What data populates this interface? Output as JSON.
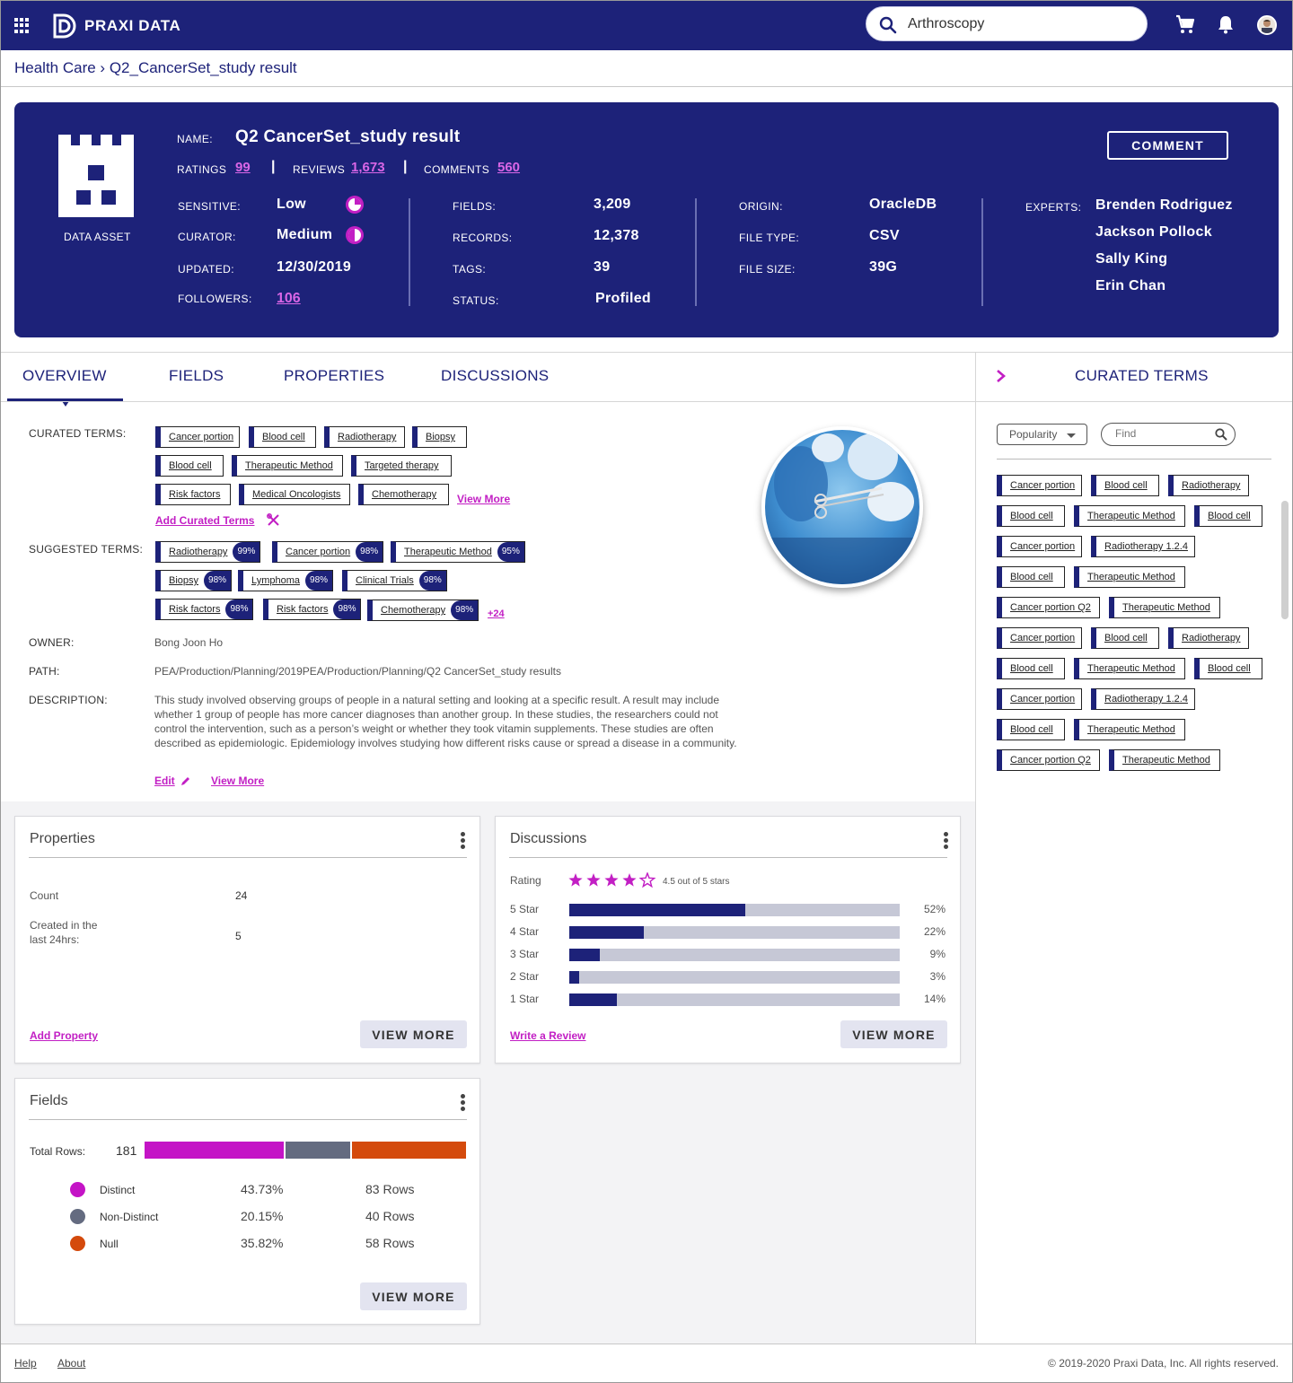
{
  "app": {
    "title": "PRAXI DATA",
    "search_value": "Arthroscopy",
    "icons": [
      "apps-grid-icon",
      "search-icon",
      "cart-icon",
      "bell-icon",
      "avatar"
    ]
  },
  "breadcrumb": "Health Care › Q2_CancerSet_study result",
  "asset": {
    "type_label": "DATA ASSET",
    "name_label": "NAME:",
    "name": "Q2 CancerSet_study result",
    "ratings_label": "RATINGS",
    "ratings": "99",
    "reviews_label": "REVIEWS",
    "reviews": "1,673",
    "comments_label": "COMMENTS",
    "comments": "560",
    "sep": "|",
    "comment_button": "COMMENT",
    "sensitive_label": "SENSITIVE:",
    "sensitive": "Low",
    "curator_label": "CURATOR:",
    "curator": "Medium",
    "updated_label": "UPDATED:",
    "updated": "12/30/2019",
    "followers_label": "FOLLOWERS:",
    "followers": "106",
    "fields_label": "FIELDS:",
    "fields": "3,209",
    "records_label": "RECORDS:",
    "records": "12,378",
    "tags_label": "TAGS:",
    "tags": "39",
    "status_label": "STATUS:",
    "status": "Profiled",
    "origin_label": "ORIGIN:",
    "origin": "OracleDB",
    "filetype_label": "FILE TYPE:",
    "filetype": "CSV",
    "filesize_label": "FILE SIZE:",
    "filesize": "39G",
    "experts_label": "EXPERTS:",
    "experts": [
      "Brenden Rodriguez",
      "Jackson Pollock",
      "Sally King",
      "Erin Chan"
    ]
  },
  "tabs": [
    "OVERVIEW",
    "FIELDS",
    "PROPERTIES",
    "DISCUSSIONS"
  ],
  "overview": {
    "curated_label": "CURATED TERMS:",
    "curated_terms": [
      "Cancer portion",
      "Blood cell",
      "Radiotherapy",
      "Biopsy",
      "Blood cell",
      "Therapeutic Method",
      "Targeted therapy",
      "Risk factors",
      "Medical Oncologists",
      "Chemotherapy"
    ],
    "view_more": "View More",
    "add_curated": "Add Curated Terms",
    "suggested_label": "SUGGESTED TERMS:",
    "suggested_terms": [
      {
        "term": "Radiotherapy",
        "pct": "99%"
      },
      {
        "term": "Cancer portion",
        "pct": "98%"
      },
      {
        "term": "Therapeutic Method",
        "pct": "95%"
      },
      {
        "term": "Biopsy",
        "pct": "98%"
      },
      {
        "term": "Lymphoma",
        "pct": "98%"
      },
      {
        "term": "Clinical Trials",
        "pct": "98%"
      },
      {
        "term": "Risk factors",
        "pct": "98%"
      },
      {
        "term": "Risk factors",
        "pct": "98%"
      },
      {
        "term": "Chemotherapy",
        "pct": "98%"
      }
    ],
    "suggested_more": "+24",
    "owner_label": "OWNER:",
    "owner": "Bong Joon Ho",
    "path_label": "PATH:",
    "path": "PEA/Production/Planning/2019PEA/Production/Planning/Q2 CancerSet_study results",
    "description_label": "DESCRIPTION:",
    "description": "This study involved observing groups of people in a natural setting and looking at a specific result. A result may include whether 1 group of people has more cancer diagnoses than another group. In these studies, the researchers could not control the intervention, such as a person’s weight or whether they took vitamin supplements. These studies are often described as epidemiologic. Epidemiology involves studying how different risks cause or spread a disease in a community.",
    "edit": "Edit",
    "view_more_desc": "View More"
  },
  "properties_panel": {
    "title": "Properties",
    "count_label": "Count",
    "count": "24",
    "created_label": "Created in the last 24hrs:",
    "created": "5",
    "add_property": "Add Property",
    "view_more": "VIEW MORE"
  },
  "discussions_panel": {
    "title": "Discussions",
    "rating_label": "Rating",
    "rating_text": "4.5 out of  5 stars",
    "rating_value": 4.5,
    "rows": [
      {
        "label": "5 Star",
        "pct": "52%",
        "fraction": 0.52
      },
      {
        "label": "4 Star",
        "pct": "22%",
        "fraction": 0.22
      },
      {
        "label": "3 Star",
        "pct": "9%",
        "fraction": 0.09
      },
      {
        "label": "2 Star",
        "pct": "3%",
        "fraction": 0.03
      },
      {
        "label": "1 Star",
        "pct": "14%",
        "fraction": 0.14
      }
    ],
    "write_review": "Write a Review",
    "view_more": "VIEW MORE"
  },
  "fields_panel": {
    "title": "Fields",
    "total_label": "Total Rows:",
    "total": "181",
    "rows": [
      {
        "label": "Distinct",
        "pct": "43.73%",
        "rows": "83 Rows",
        "color": "#c414c6",
        "fraction": 0.4373
      },
      {
        "label": "Non-Distinct",
        "pct": "20.15%",
        "rows": "40 Rows",
        "color": "#646b80",
        "fraction": 0.2015
      },
      {
        "label": "Null",
        "pct": "35.82%",
        "rows": "58 Rows",
        "color": "#d44a0c",
        "fraction": 0.3582
      }
    ],
    "view_more": "VIEW MORE"
  },
  "sidebar": {
    "title": "CURATED TERMS",
    "sort": "Popularity",
    "find_placeholder": "Find",
    "terms": [
      [
        "Cancer portion",
        "Blood cell",
        "Radiotherapy"
      ],
      [
        "Blood cell",
        "Therapeutic Method",
        "Blood cell"
      ],
      [
        "Cancer portion",
        "Radiotherapy 1.2.4"
      ],
      [
        "Blood cell",
        "Therapeutic Method"
      ],
      [
        "Cancer portion Q2",
        "Therapeutic Method"
      ],
      [
        "Cancer portion",
        "Blood cell",
        "Radiotherapy"
      ],
      [
        "Blood cell",
        "Therapeutic Method",
        "Blood cell"
      ],
      [
        "Cancer portion",
        "Radiotherapy 1.2.4"
      ],
      [
        "Blood cell",
        "Therapeutic Method"
      ],
      [
        "Cancer portion Q2",
        "Therapeutic Method"
      ]
    ]
  },
  "footer": {
    "help": "Help",
    "about": "About",
    "copyright": "© 2019-2020 Praxi Data, Inc. All rights reserved."
  },
  "colors": {
    "brand": "#1d2279",
    "accent": "#c21fc4",
    "null": "#d44a0c",
    "nondistinct": "#646b80"
  }
}
